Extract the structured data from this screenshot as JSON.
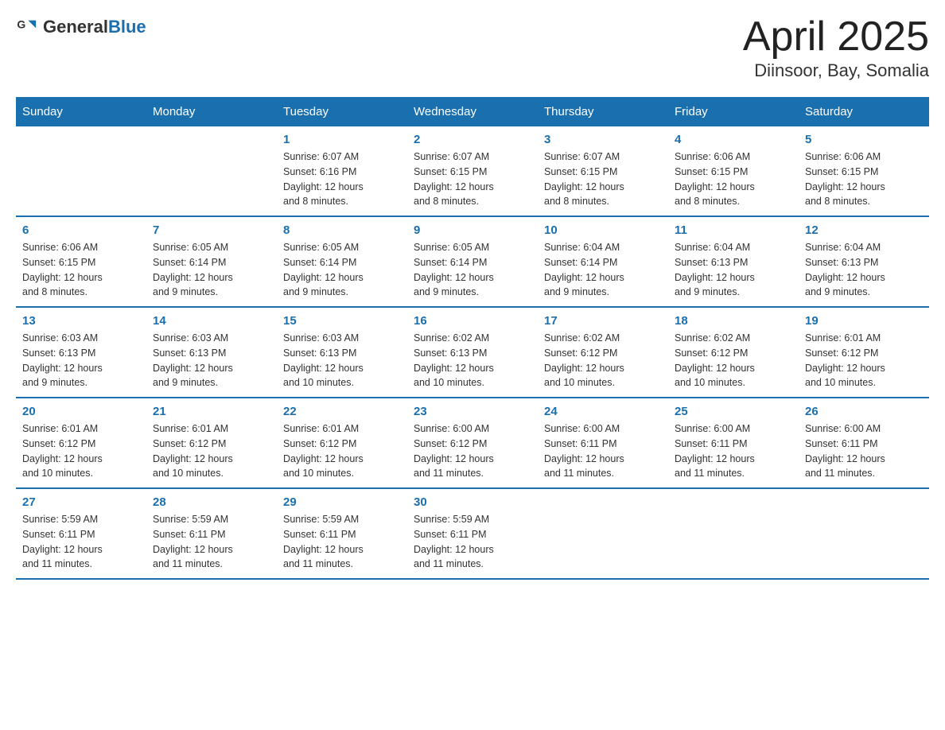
{
  "header": {
    "logo_general": "General",
    "logo_blue": "Blue",
    "title": "April 2025",
    "subtitle": "Diinsoor, Bay, Somalia"
  },
  "calendar": {
    "days_of_week": [
      "Sunday",
      "Monday",
      "Tuesday",
      "Wednesday",
      "Thursday",
      "Friday",
      "Saturday"
    ],
    "weeks": [
      {
        "days": [
          {
            "num": "",
            "info": ""
          },
          {
            "num": "",
            "info": ""
          },
          {
            "num": "1",
            "info": "Sunrise: 6:07 AM\nSunset: 6:16 PM\nDaylight: 12 hours\nand 8 minutes."
          },
          {
            "num": "2",
            "info": "Sunrise: 6:07 AM\nSunset: 6:15 PM\nDaylight: 12 hours\nand 8 minutes."
          },
          {
            "num": "3",
            "info": "Sunrise: 6:07 AM\nSunset: 6:15 PM\nDaylight: 12 hours\nand 8 minutes."
          },
          {
            "num": "4",
            "info": "Sunrise: 6:06 AM\nSunset: 6:15 PM\nDaylight: 12 hours\nand 8 minutes."
          },
          {
            "num": "5",
            "info": "Sunrise: 6:06 AM\nSunset: 6:15 PM\nDaylight: 12 hours\nand 8 minutes."
          }
        ]
      },
      {
        "days": [
          {
            "num": "6",
            "info": "Sunrise: 6:06 AM\nSunset: 6:15 PM\nDaylight: 12 hours\nand 8 minutes."
          },
          {
            "num": "7",
            "info": "Sunrise: 6:05 AM\nSunset: 6:14 PM\nDaylight: 12 hours\nand 9 minutes."
          },
          {
            "num": "8",
            "info": "Sunrise: 6:05 AM\nSunset: 6:14 PM\nDaylight: 12 hours\nand 9 minutes."
          },
          {
            "num": "9",
            "info": "Sunrise: 6:05 AM\nSunset: 6:14 PM\nDaylight: 12 hours\nand 9 minutes."
          },
          {
            "num": "10",
            "info": "Sunrise: 6:04 AM\nSunset: 6:14 PM\nDaylight: 12 hours\nand 9 minutes."
          },
          {
            "num": "11",
            "info": "Sunrise: 6:04 AM\nSunset: 6:13 PM\nDaylight: 12 hours\nand 9 minutes."
          },
          {
            "num": "12",
            "info": "Sunrise: 6:04 AM\nSunset: 6:13 PM\nDaylight: 12 hours\nand 9 minutes."
          }
        ]
      },
      {
        "days": [
          {
            "num": "13",
            "info": "Sunrise: 6:03 AM\nSunset: 6:13 PM\nDaylight: 12 hours\nand 9 minutes."
          },
          {
            "num": "14",
            "info": "Sunrise: 6:03 AM\nSunset: 6:13 PM\nDaylight: 12 hours\nand 9 minutes."
          },
          {
            "num": "15",
            "info": "Sunrise: 6:03 AM\nSunset: 6:13 PM\nDaylight: 12 hours\nand 10 minutes."
          },
          {
            "num": "16",
            "info": "Sunrise: 6:02 AM\nSunset: 6:13 PM\nDaylight: 12 hours\nand 10 minutes."
          },
          {
            "num": "17",
            "info": "Sunrise: 6:02 AM\nSunset: 6:12 PM\nDaylight: 12 hours\nand 10 minutes."
          },
          {
            "num": "18",
            "info": "Sunrise: 6:02 AM\nSunset: 6:12 PM\nDaylight: 12 hours\nand 10 minutes."
          },
          {
            "num": "19",
            "info": "Sunrise: 6:01 AM\nSunset: 6:12 PM\nDaylight: 12 hours\nand 10 minutes."
          }
        ]
      },
      {
        "days": [
          {
            "num": "20",
            "info": "Sunrise: 6:01 AM\nSunset: 6:12 PM\nDaylight: 12 hours\nand 10 minutes."
          },
          {
            "num": "21",
            "info": "Sunrise: 6:01 AM\nSunset: 6:12 PM\nDaylight: 12 hours\nand 10 minutes."
          },
          {
            "num": "22",
            "info": "Sunrise: 6:01 AM\nSunset: 6:12 PM\nDaylight: 12 hours\nand 10 minutes."
          },
          {
            "num": "23",
            "info": "Sunrise: 6:00 AM\nSunset: 6:12 PM\nDaylight: 12 hours\nand 11 minutes."
          },
          {
            "num": "24",
            "info": "Sunrise: 6:00 AM\nSunset: 6:11 PM\nDaylight: 12 hours\nand 11 minutes."
          },
          {
            "num": "25",
            "info": "Sunrise: 6:00 AM\nSunset: 6:11 PM\nDaylight: 12 hours\nand 11 minutes."
          },
          {
            "num": "26",
            "info": "Sunrise: 6:00 AM\nSunset: 6:11 PM\nDaylight: 12 hours\nand 11 minutes."
          }
        ]
      },
      {
        "days": [
          {
            "num": "27",
            "info": "Sunrise: 5:59 AM\nSunset: 6:11 PM\nDaylight: 12 hours\nand 11 minutes."
          },
          {
            "num": "28",
            "info": "Sunrise: 5:59 AM\nSunset: 6:11 PM\nDaylight: 12 hours\nand 11 minutes."
          },
          {
            "num": "29",
            "info": "Sunrise: 5:59 AM\nSunset: 6:11 PM\nDaylight: 12 hours\nand 11 minutes."
          },
          {
            "num": "30",
            "info": "Sunrise: 5:59 AM\nSunset: 6:11 PM\nDaylight: 12 hours\nand 11 minutes."
          },
          {
            "num": "",
            "info": ""
          },
          {
            "num": "",
            "info": ""
          },
          {
            "num": "",
            "info": ""
          }
        ]
      }
    ]
  }
}
